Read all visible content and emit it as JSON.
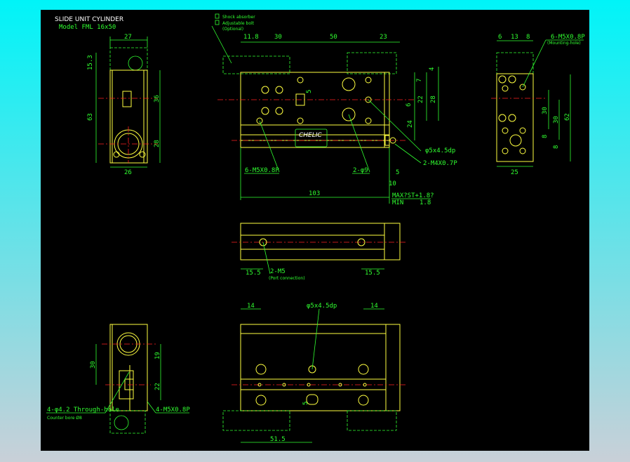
{
  "title": {
    "line1": "SLIDE UNIT CYLINDER",
    "line2": "Model  FML 16x50"
  },
  "legend": {
    "a": "Shock absorber",
    "b": "Adjustable bolt",
    "c": "(Optional)"
  },
  "end_view_left": {
    "dims": [
      "27",
      "15.3",
      "63",
      "36",
      "28",
      "26"
    ]
  },
  "top_view": {
    "dims": [
      "11.8",
      "30",
      "50",
      "23",
      "4",
      "7",
      "5",
      "6",
      "22",
      "28",
      "24",
      "5",
      "10",
      "103"
    ],
    "labels": {
      "holes": "6-M5X0.8P",
      "pins": "2-φ9",
      "dowel": "φ5x4.5dp",
      "tap": "2-M4X0.7P",
      "max": "MAX?ST+1.8?",
      "min": "MIN",
      "min_val": "1.8"
    },
    "nameplate": "CHELIC"
  },
  "end_view_right": {
    "dims": [
      "6",
      "13",
      "8",
      "30",
      "30",
      "62",
      "8",
      "8",
      "25"
    ],
    "label": "6-M5X0.8P",
    "sublabel": "(Mounting-hole)"
  },
  "side_view": {
    "dims": [
      "15.5",
      "15.5"
    ],
    "label": "2-M5",
    "sublabel": "(Port connection)"
  },
  "bottom_view": {
    "dims": [
      "14",
      "14",
      "5",
      "51.5"
    ],
    "label": "φ5x4.5dp"
  },
  "bottom_left_view": {
    "dims": [
      "30",
      "19",
      "22"
    ],
    "label1": "4-φ4.2 Through-hole",
    "label2": "Counter bore  Ø8",
    "label3": "4-M5X0.8P"
  },
  "colors": {
    "outline": "#ffff40",
    "dimension": "#30ff30",
    "centerline": "#ff2020",
    "background": "#000000"
  }
}
